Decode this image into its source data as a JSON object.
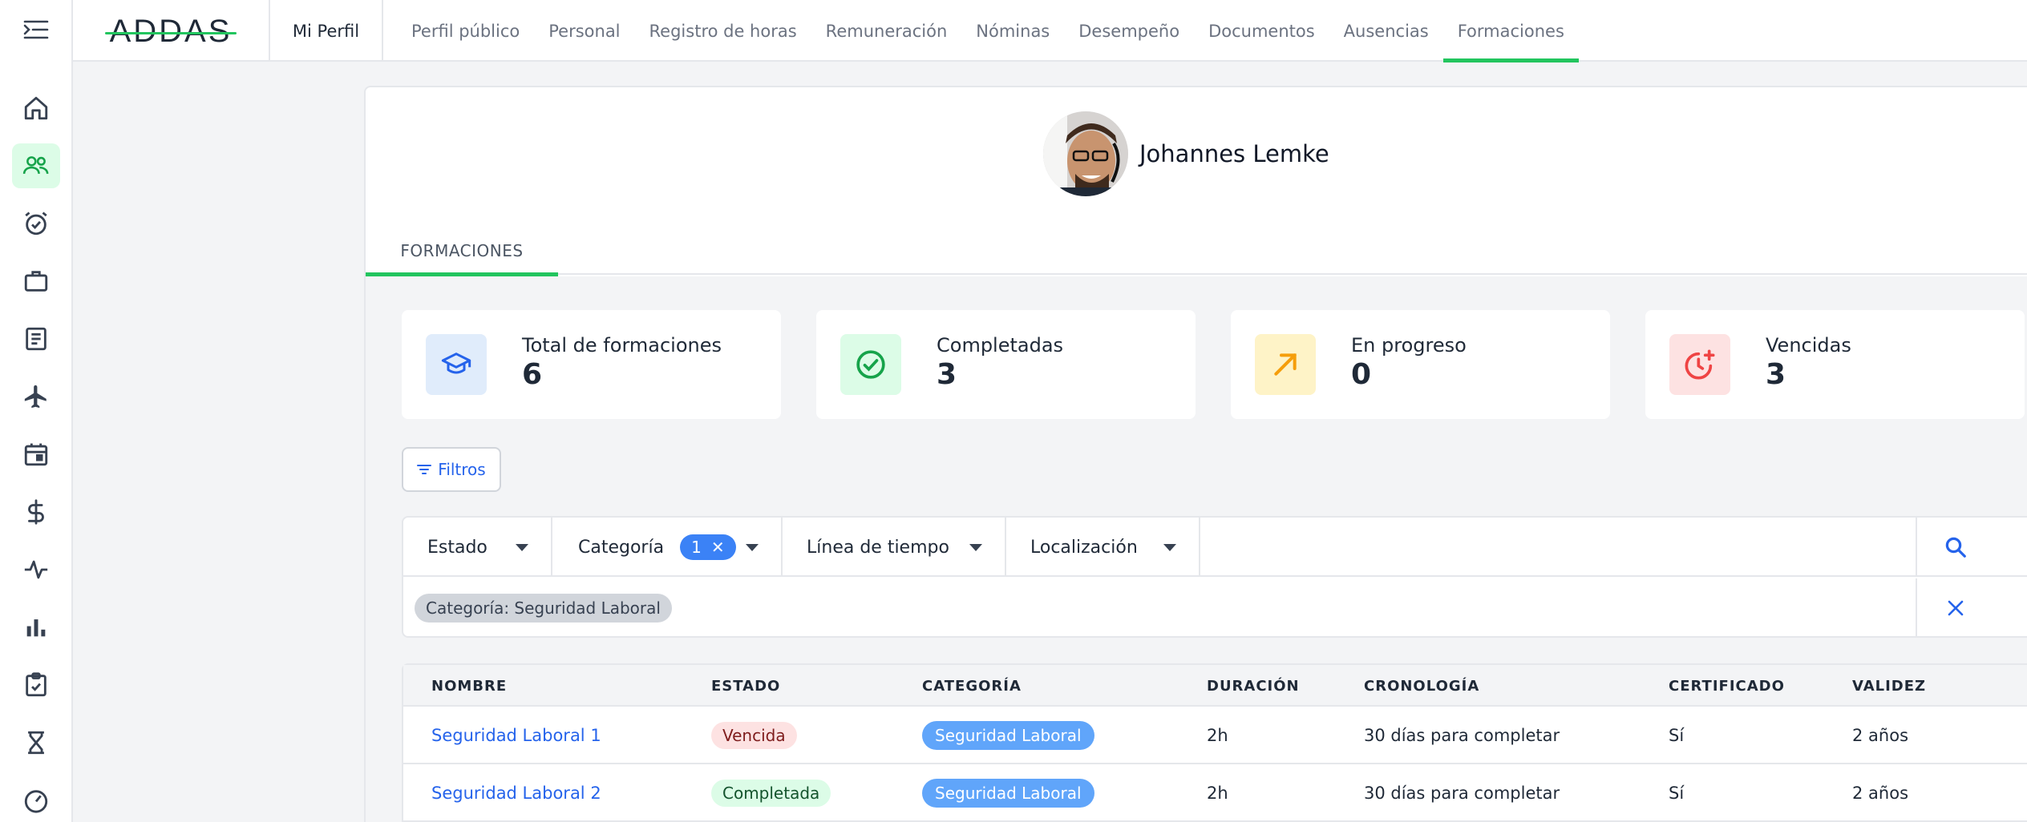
{
  "logo": {
    "text": "ADDAS"
  },
  "header": {
    "mi_perfil": "Mi Perfil",
    "tabs": [
      {
        "label": "Perfil público"
      },
      {
        "label": "Personal"
      },
      {
        "label": "Registro de horas"
      },
      {
        "label": "Remuneración"
      },
      {
        "label": "Nóminas"
      },
      {
        "label": "Desempeño"
      },
      {
        "label": "Documentos"
      },
      {
        "label": "Ausencias"
      },
      {
        "label": "Formaciones",
        "active": true
      }
    ]
  },
  "sidebar": {
    "items": [
      {
        "icon": "home-icon"
      },
      {
        "icon": "people-icon",
        "active": true
      },
      {
        "icon": "alarm-check-icon"
      },
      {
        "icon": "briefcase-icon"
      },
      {
        "icon": "document-icon"
      },
      {
        "icon": "airplane-icon"
      },
      {
        "icon": "calendar-icon"
      },
      {
        "icon": "dollar-icon"
      },
      {
        "icon": "activity-icon"
      },
      {
        "icon": "bar-chart-icon"
      },
      {
        "icon": "clipboard-check-icon"
      },
      {
        "icon": "hourglass-icon"
      },
      {
        "icon": "speedometer-icon"
      }
    ]
  },
  "profile": {
    "name": "Johannes Lemke"
  },
  "subtab": {
    "label": "FORMACIONES"
  },
  "stats": [
    {
      "label": "Total de formaciones",
      "value": "6",
      "icon": "graduation-cap-icon",
      "icon_bg": "#e0ecfb",
      "icon_color": "#2563eb"
    },
    {
      "label": "Completadas",
      "value": "3",
      "icon": "check-circle-icon",
      "icon_bg": "#dcfce7",
      "icon_color": "#16a34a"
    },
    {
      "label": "En progreso",
      "value": "0",
      "icon": "arrow-up-right-icon",
      "icon_bg": "#fef3c7",
      "icon_color": "#f59e0b"
    },
    {
      "label": "Vencidas",
      "value": "3",
      "icon": "clock-plus-icon",
      "icon_bg": "#fde2e2",
      "icon_color": "#ef4444"
    }
  ],
  "filters": {
    "button_label": "Filtros",
    "estado": "Estado",
    "categoria": "Categoría",
    "categoria_count": "1",
    "timeline": "Línea de tiempo",
    "localizacion": "Localización",
    "applied": "Categoría: Seguridad Laboral"
  },
  "table": {
    "headers": [
      "NOMBRE",
      "ESTADO",
      "CATEGORÍA",
      "DURACIÓN",
      "CRONOLOGÍA",
      "CERTIFICADO",
      "VALIDEZ"
    ],
    "rows": [
      {
        "nombre": "Seguridad Laboral 1",
        "estado": "Vencida",
        "categoria": "Seguridad Laboral",
        "duracion": "2h",
        "cronologia": "30 días para completar",
        "certificado": "Sí",
        "validez": "2 años"
      },
      {
        "nombre": "Seguridad Laboral 2",
        "estado": "Completada",
        "categoria": "Seguridad Laboral",
        "duracion": "2h",
        "cronologia": "30 días para completar",
        "certificado": "Sí",
        "validez": "2 años"
      }
    ]
  }
}
